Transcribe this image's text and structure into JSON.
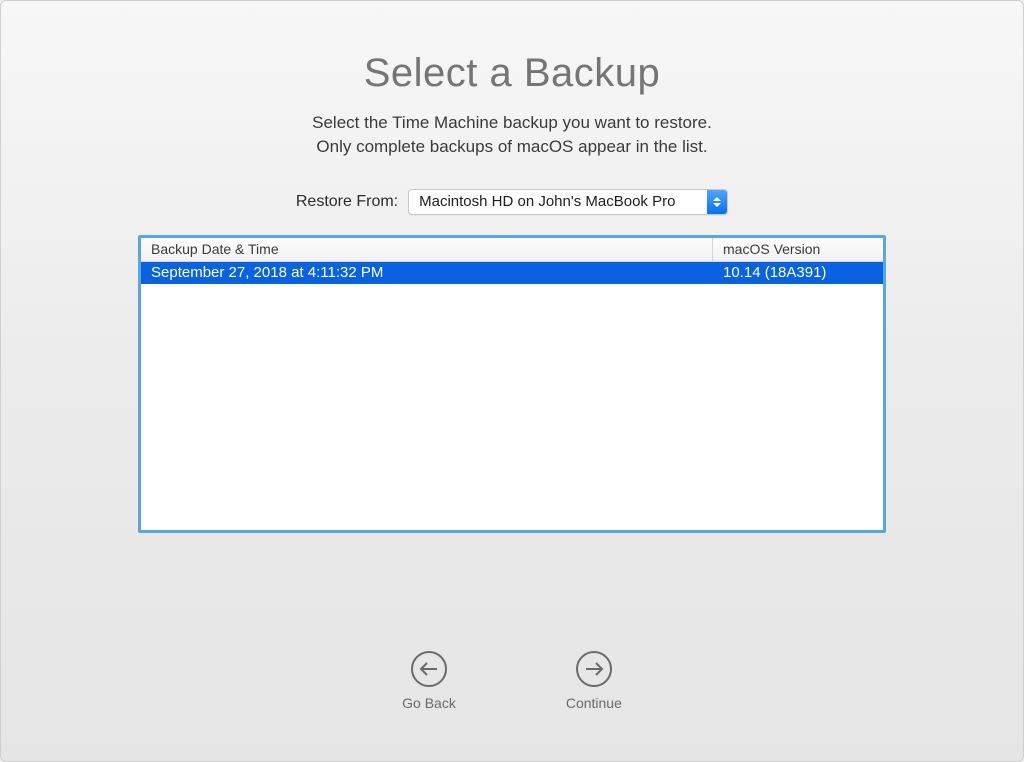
{
  "header": {
    "title": "Select a Backup",
    "subtitle_line1": "Select the Time Machine backup you want to restore.",
    "subtitle_line2": "Only complete backups of macOS appear in the list."
  },
  "restore": {
    "label": "Restore From:",
    "selected": "Macintosh HD on John's MacBook Pro"
  },
  "table": {
    "columns": {
      "date": "Backup Date & Time",
      "version": "macOS Version"
    },
    "rows": [
      {
        "date": "September 27, 2018 at 4:11:32 PM",
        "version": "10.14 (18A391)",
        "selected": true
      }
    ]
  },
  "footer": {
    "back": "Go Back",
    "continue": "Continue"
  }
}
